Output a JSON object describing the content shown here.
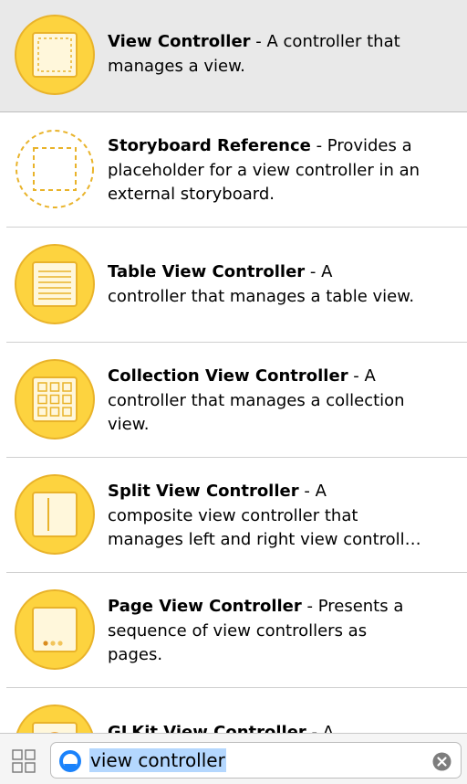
{
  "library": {
    "items": [
      {
        "title": "View Controller",
        "desc": " - A controller that",
        "desc2": "manages a view.",
        "desc3": "",
        "icon": "view-controller-icon",
        "selected": true
      },
      {
        "title": "Storyboard Reference",
        "desc": " - Provides a",
        "desc2": "placeholder for a view controller in an",
        "desc3": "external storyboard.",
        "icon": "storyboard-reference-icon",
        "selected": false
      },
      {
        "title": "Table View Controller",
        "desc": " - A",
        "desc2": "controller that manages a table view.",
        "desc3": "",
        "icon": "table-view-controller-icon",
        "selected": false
      },
      {
        "title": "Collection View Controller",
        "desc": " - A",
        "desc2": "controller that manages a collection",
        "desc3": "view.",
        "icon": "collection-view-controller-icon",
        "selected": false
      },
      {
        "title": "Split View Controller",
        "desc": " - A",
        "desc2": "composite view controller that",
        "desc3": "manages left and right view controll…",
        "icon": "split-view-controller-icon",
        "selected": false
      },
      {
        "title": "Page View Controller",
        "desc": " - Presents a",
        "desc2": "sequence of view controllers as",
        "desc3": "pages.",
        "icon": "page-view-controller-icon",
        "selected": false
      },
      {
        "title": "GLKit View Controller",
        "desc": " - A",
        "desc2": "",
        "desc3": "",
        "icon": "glkit-view-controller-icon",
        "selected": false
      }
    ]
  },
  "search": {
    "value": "view controller"
  },
  "colors": {
    "icon_fill": "#fdd33f",
    "icon_stroke": "#e9b32a",
    "icon_inner": "#fff7db",
    "selection_bg": "#e9e9e9",
    "search_highlight": "#b4d7fe",
    "filter_blue": "#1a82fb"
  }
}
